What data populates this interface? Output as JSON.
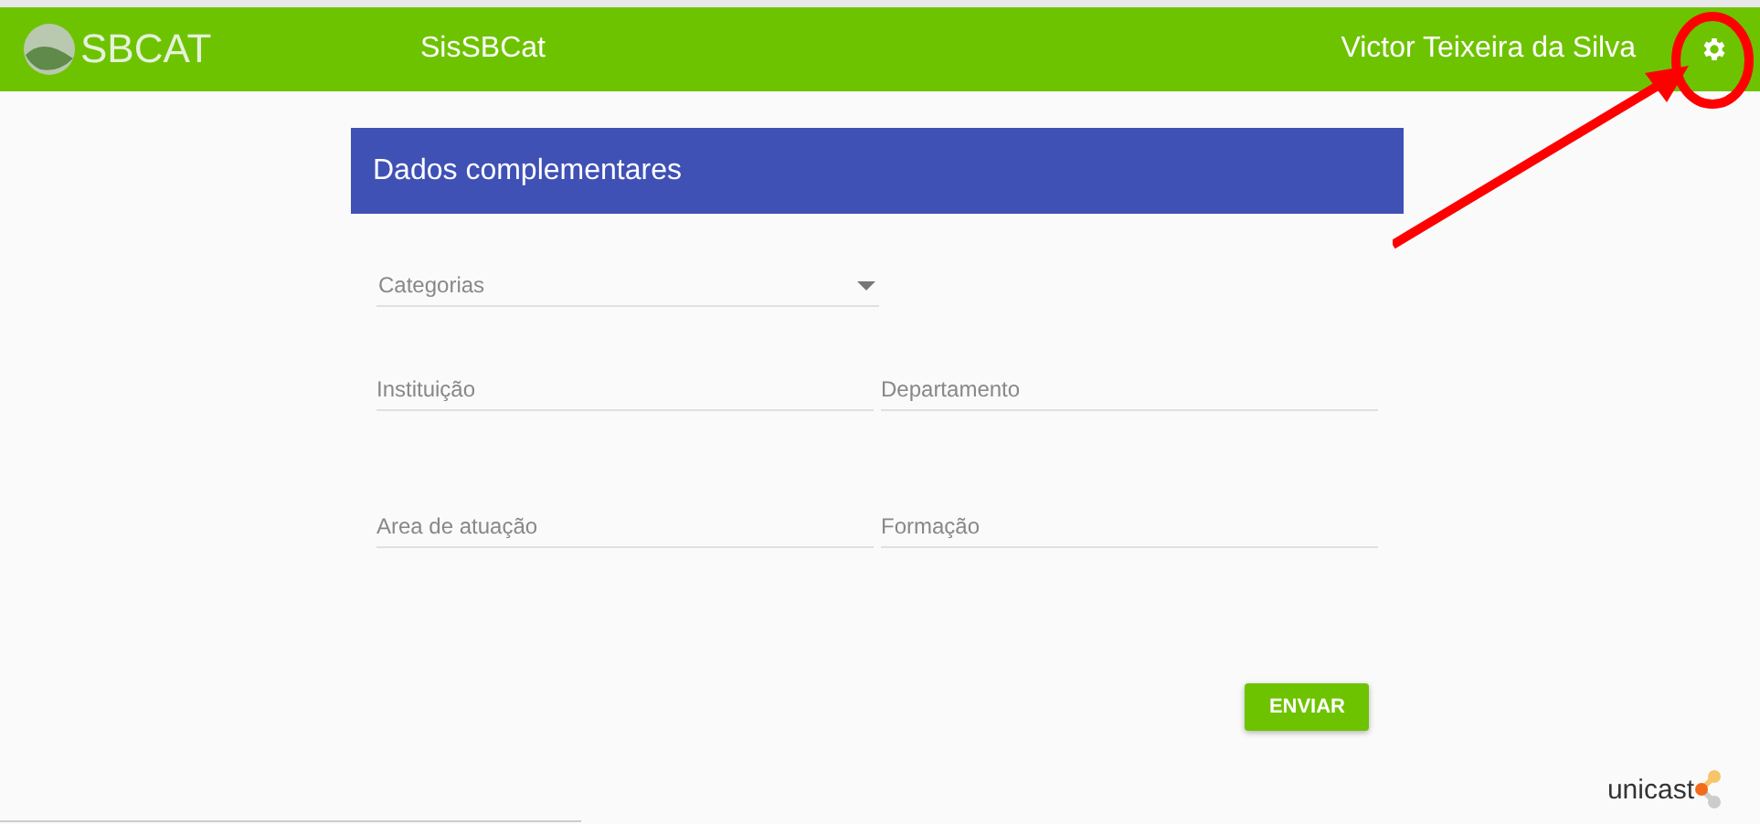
{
  "header": {
    "logo_text": "SBCAT",
    "app_title": "SisSBCat",
    "user_name": "Victor Teixeira da Silva"
  },
  "card": {
    "title": "Dados complementares",
    "select": {
      "placeholder": "Categorias"
    },
    "fields": [
      {
        "placeholder": "Instituição"
      },
      {
        "placeholder": "Departamento"
      },
      {
        "placeholder": "Area de atuação"
      },
      {
        "placeholder": "Formação"
      }
    ],
    "submit": "ENVIAR"
  },
  "footer": {
    "brand": "unicast"
  }
}
